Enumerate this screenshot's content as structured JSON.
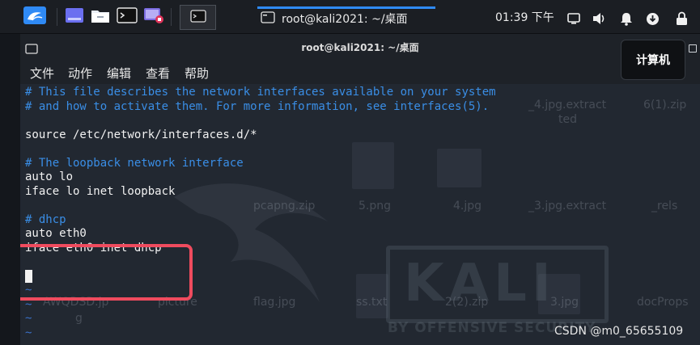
{
  "panel": {
    "launchers": [
      "kali-menu-icon",
      "workspace-icon",
      "files-icon",
      "terminal-icon",
      "screen-recorder-icon"
    ],
    "active_app_icon": "terminal-icon",
    "task_title": "root@kali2021: ~/桌面",
    "clock": "01:39 下午",
    "tray": [
      "display-icon",
      "volume-icon",
      "notification-bell-icon",
      "update-icon",
      "lock-icon"
    ],
    "accent": "#2f8af5"
  },
  "window": {
    "title": "root@kali2021: ~/桌面",
    "menu": [
      "文件",
      "动作",
      "编辑",
      "查看",
      "帮助"
    ]
  },
  "editor": {
    "lines": [
      {
        "text": "# This file describes the network interfaces available on your system",
        "kind": "comment"
      },
      {
        "text": "# and how to activate them. For more information, see interfaces(5).",
        "kind": "comment"
      },
      {
        "text": "",
        "kind": "plain"
      },
      {
        "text": "source /etc/network/interfaces.d/*",
        "kind": "plain"
      },
      {
        "text": "",
        "kind": "plain"
      },
      {
        "text": "# The loopback network interface",
        "kind": "comment"
      },
      {
        "text": "auto lo",
        "kind": "plain"
      },
      {
        "text": "iface lo inet loopback",
        "kind": "plain"
      },
      {
        "text": "",
        "kind": "plain"
      },
      {
        "text": "# dhcp",
        "kind": "comment"
      },
      {
        "text": "auto eth0",
        "kind": "plain"
      },
      {
        "text": "iface eth0 inet dhcp",
        "kind": "plain"
      },
      {
        "text": "",
        "kind": "plain"
      },
      {
        "text": "",
        "kind": "cursor"
      },
      {
        "text": "~",
        "kind": "tilde"
      },
      {
        "text": "~",
        "kind": "tilde"
      },
      {
        "text": "~",
        "kind": "tilde"
      },
      {
        "text": "~",
        "kind": "tilde"
      }
    ],
    "comment_color": "#3a8ee6",
    "highlight_color": "#ef4b5e"
  },
  "desktop_ghosts": {
    "labels": [
      {
        "id": "g1",
        "text": "_4.jpg.extract"
      },
      {
        "id": "g2",
        "text": "ted"
      },
      {
        "id": "g3",
        "text": "6(1).zip"
      },
      {
        "id": "g4",
        "text": "pcapng.zip"
      },
      {
        "id": "g5",
        "text": "5.png"
      },
      {
        "id": "g6",
        "text": "4.jpg"
      },
      {
        "id": "g7",
        "text": "_3.jpg.extract"
      },
      {
        "id": "g8",
        "text": "_rels"
      },
      {
        "id": "g9",
        "text": "AWQDSD.jp"
      },
      {
        "id": "g10",
        "text": "g"
      },
      {
        "id": "g11",
        "text": "picture"
      },
      {
        "id": "g12",
        "text": "flag.jpg"
      },
      {
        "id": "g13",
        "text": "ss.txt"
      },
      {
        "id": "g14",
        "text": "2(2).zip"
      },
      {
        "id": "g15",
        "text": "3.jpg"
      },
      {
        "id": "g16",
        "text": "docProps"
      }
    ],
    "watermark_title": "KALI",
    "watermark_sub": "BY OFFENSIVE SECURITY"
  },
  "popup": {
    "label": "计算机"
  },
  "watermark": "CSDN @m0_65655109"
}
